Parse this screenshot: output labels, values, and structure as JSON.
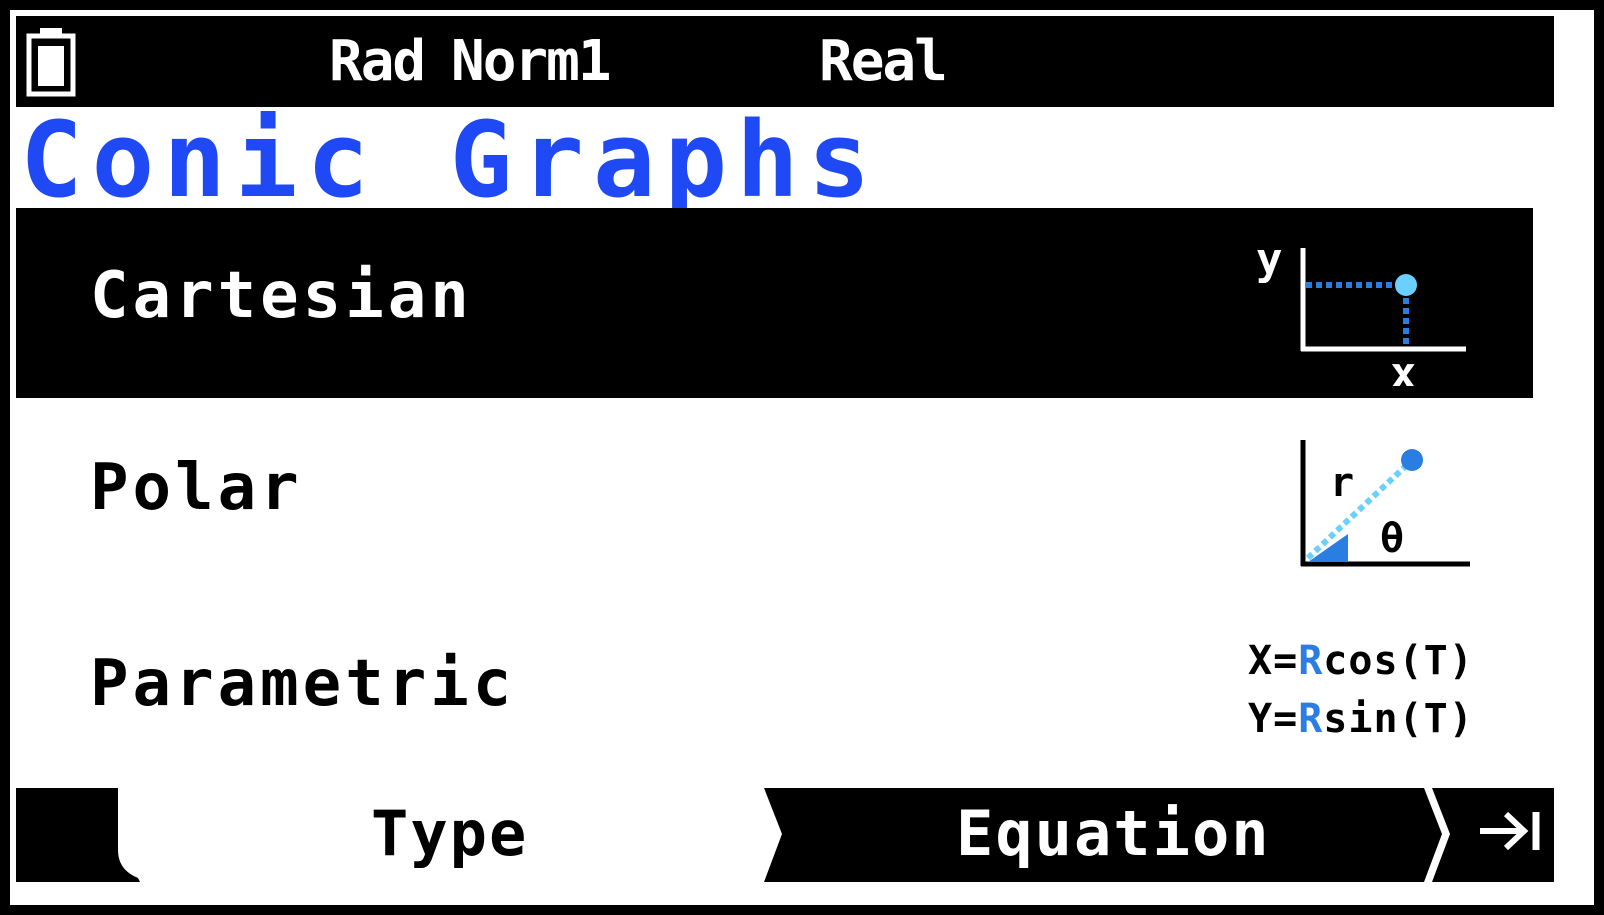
{
  "status_bar": {
    "battery_icon": "battery-icon",
    "angle_mode": "Rad",
    "display_mode": "Norm1",
    "complex_mode": "Real"
  },
  "app_title": "Conic Graphs",
  "menu": {
    "items": [
      {
        "label": "Cartesian",
        "selected": true,
        "icon": "cartesian-graph-icon",
        "icon_labels": {
          "y": "y",
          "x": "x"
        }
      },
      {
        "label": "Polar",
        "selected": false,
        "icon": "polar-graph-icon",
        "icon_labels": {
          "r": "r",
          "theta": "θ"
        }
      },
      {
        "label": "Parametric",
        "selected": false,
        "icon": "parametric-equation-icon",
        "eq1": {
          "lhs": "X",
          "eq": "=",
          "r": "R",
          "fn": "cos(T)"
        },
        "eq2": {
          "lhs": "Y",
          "eq": "=",
          "r": "R",
          "fn": "sin(T)"
        }
      }
    ]
  },
  "function_keys": {
    "f1_label": "Type",
    "f2_label": "Equation",
    "f3_icon": "next-page-icon"
  },
  "colors": {
    "title_blue": "#1f49f4",
    "icon_blue": "#2a7de1",
    "icon_light_blue": "#6bd0ff",
    "background": "#ffffff",
    "bar": "#000000"
  }
}
